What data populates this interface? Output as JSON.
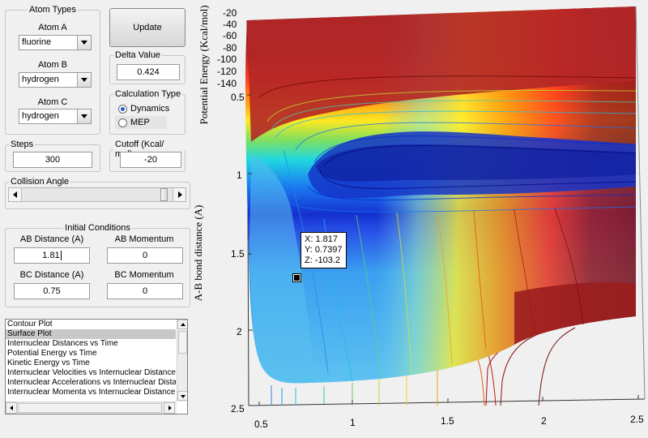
{
  "atom_types": {
    "title": "Atom Types",
    "atom_a": {
      "label": "Atom A",
      "value": "fluorine"
    },
    "atom_b": {
      "label": "Atom B",
      "value": "hydrogen"
    },
    "atom_c": {
      "label": "Atom C",
      "value": "hydrogen"
    }
  },
  "update_button": "Update",
  "delta_value": {
    "title": "Delta Value",
    "value": "0.424"
  },
  "calculation_type": {
    "title": "Calculation Type",
    "options": [
      "Dynamics",
      "MEP"
    ],
    "selected": "Dynamics"
  },
  "steps": {
    "title": "Steps",
    "value": "300"
  },
  "cutoff": {
    "title": "Cutoff (Kcal/ mol)",
    "value": "-20"
  },
  "collision_angle": {
    "title": "Collision Angle",
    "slider_fraction": 0.97
  },
  "initial_conditions": {
    "title": "Initial Conditions",
    "ab_distance": {
      "label": "AB Distance (A)",
      "value": "1.81"
    },
    "ab_momentum": {
      "label": "AB Momentum",
      "value": "0"
    },
    "bc_distance": {
      "label": "BC Distance (A)",
      "value": "0.75"
    },
    "bc_momentum": {
      "label": "BC Momentum",
      "value": "0"
    }
  },
  "plot_list": {
    "items": [
      "Contour Plot",
      "Surface Plot",
      "Internuclear Distances vs Time",
      "Potential Energy vs Time",
      "Kinetic Energy vs Time",
      "Internuclear Velocities vs Internuclear Distance",
      "Internuclear Accelerations vs Internuclear Distance",
      "Internuclear Momenta vs Internuclear Distance"
    ],
    "selected": "Surface Plot"
  },
  "chart_data": {
    "type": "surface",
    "zlabel": "Potential Energy (Kcal/mol)",
    "ylabel": "A-B bond distance (A)",
    "z_ticks": [
      "-20",
      "-40",
      "-60",
      "-80",
      "-100",
      "-120",
      "-140"
    ],
    "y_ticks": [
      "0.5",
      "1",
      "1.5",
      "2",
      "2.5"
    ],
    "x_ticks": [
      "0.5",
      "1",
      "1.5",
      "2",
      "2.5"
    ],
    "datatip": {
      "x": "X: 1.817",
      "y": "Y: 0.7397",
      "z": "Z: -103.2"
    },
    "colormap": "jet"
  }
}
